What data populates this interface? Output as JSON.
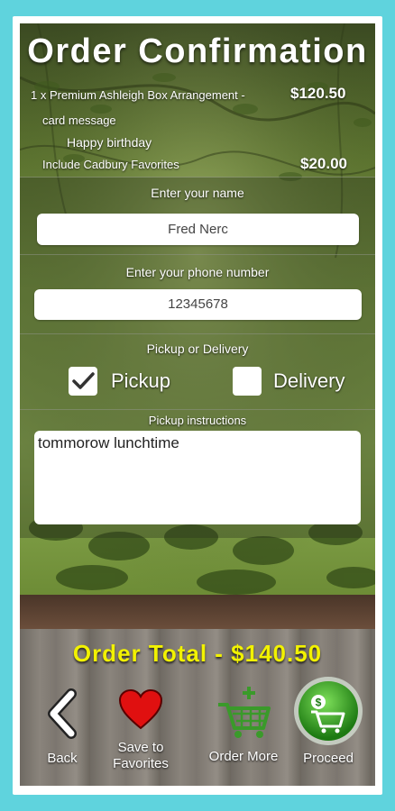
{
  "header": {
    "title": "Order Confirmation"
  },
  "order": {
    "item_line": "1 x Premium Ashleigh Box Arrangement -",
    "item_price": "$120.50",
    "card_message_label": "card message",
    "card_message": "Happy birthday",
    "extra_line": "Include Cadbury Favorites",
    "extra_price": "$20.00"
  },
  "form": {
    "name_label": "Enter your name",
    "name_value": "Fred Nerc",
    "phone_label": "Enter your phone number",
    "phone_value": "12345678",
    "pickup_delivery_label": "Pickup or Delivery",
    "pickup_label": "Pickup",
    "pickup_checked": true,
    "delivery_label": "Delivery",
    "delivery_checked": false,
    "instructions_label": "Pickup instructions",
    "instructions_value": "tommorow lunchtime"
  },
  "total": {
    "text": "Order Total - $140.50"
  },
  "actions": {
    "back_label": "Back",
    "save_label_1": "Save to",
    "save_label_2": "Favorites",
    "order_more_label": "Order More",
    "proceed_label": "Proceed"
  },
  "colors": {
    "frame_bg": "#5fd3dd",
    "total_color": "#f2f200",
    "heart_color": "#e01010",
    "cart_green": "#3a9a2a"
  },
  "icons": {
    "back": "chevron-left-icon",
    "save": "heart-icon",
    "order_more": "cart-plus-icon",
    "proceed": "cart-dollar-icon",
    "checkbox": "checkmark-icon"
  }
}
